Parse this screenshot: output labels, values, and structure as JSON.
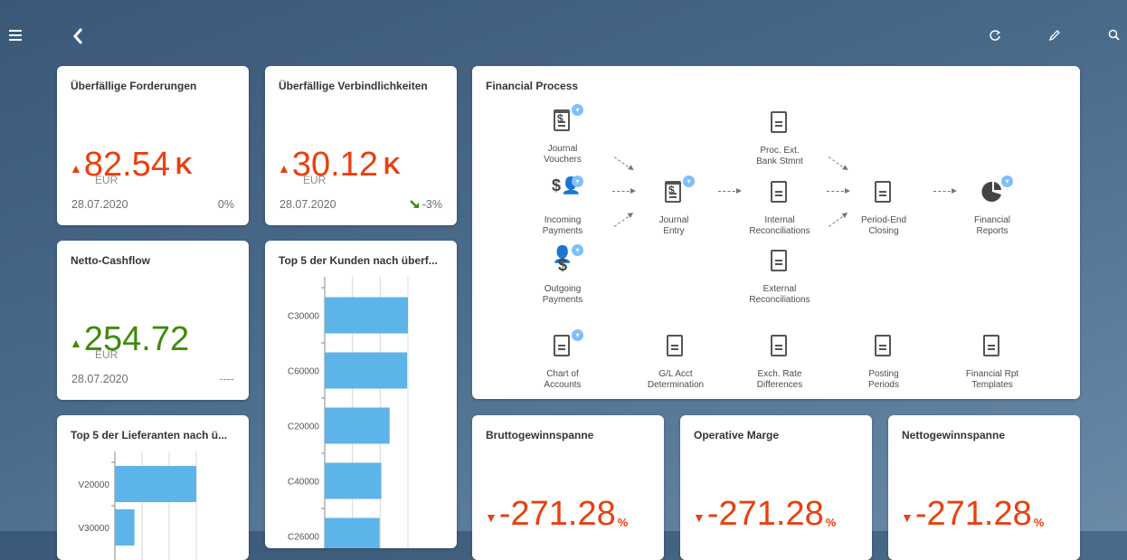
{
  "header": {
    "menu_icon": "hamburger-menu-icon",
    "back_icon": "back-chevron-icon",
    "refresh_icon": "refresh-icon",
    "edit_icon": "pencil-icon",
    "search_icon": "search-icon"
  },
  "tiles": {
    "receivables": {
      "title": "Überfällige Forderungen",
      "value": "82.54",
      "scale": "K",
      "unit": "EUR",
      "date": "28.07.2020",
      "delta": "0%",
      "trend": "up"
    },
    "payables": {
      "title": "Überfällige Verbindlichkeiten",
      "value": "30.12",
      "scale": "K",
      "unit": "EUR",
      "date": "28.07.2020",
      "delta": "-3%",
      "trend": "up"
    },
    "cashflow": {
      "title": "Netto-Cashflow",
      "value": "254.72",
      "unit": "EUR",
      "date": "28.07.2020",
      "delta": "----",
      "trend": "up"
    },
    "top_customers": {
      "title": "Top 5 der Kunden nach überf..."
    },
    "top_suppliers": {
      "title": "Top 5 der Lieferanten nach ü..."
    },
    "gross_margin": {
      "title": "Bruttogewinnspanne",
      "value": "-271.28",
      "unit": "%"
    },
    "operating_margin": {
      "title": "Operative Marge",
      "value": "-271.28",
      "unit": "%"
    },
    "net_margin": {
      "title": "Nettogewinnspanne",
      "value": "-271.28",
      "unit": "%"
    }
  },
  "financial_process": {
    "title": "Financial Process",
    "nodes": {
      "journal_vouchers": "Journal\nVouchers",
      "incoming_payments": "Incoming\nPayments",
      "outgoing_payments": "Outgoing\nPayments",
      "journal_entry": "Journal\nEntry",
      "proc_ext_bank": "Proc. Ext.\nBank Stmnt",
      "internal_recon": "Internal\nReconciliations",
      "external_recon": "External\nReconciliations",
      "period_end": "Period-End\nClosing",
      "financial_reports": "Financial\nReports",
      "chart_of_accounts": "Chart of\nAccounts",
      "gl_acct": "G/L Acct\nDetermination",
      "exch_rate": "Exch. Rate\nDifferences",
      "posting_periods": "Posting\nPeriods",
      "fin_rpt_templates": "Financial Rpt\nTemplates"
    }
  },
  "chart_data": [
    {
      "type": "bar",
      "orientation": "horizontal",
      "title": "Top 5 der Kunden nach überf...",
      "categories": [
        "C30000",
        "C60000",
        "C20000",
        "C40000",
        "C26000"
      ],
      "values": [
        100,
        99,
        78,
        68,
        66
      ]
    },
    {
      "type": "bar",
      "orientation": "horizontal",
      "title": "Top 5 der Lieferanten nach ü...",
      "categories": [
        "V20000",
        "V30000"
      ],
      "values": [
        100,
        24
      ]
    }
  ],
  "colors": {
    "negative": "#e9400e",
    "positive": "#3f8b09",
    "bar": "#5cb4e8",
    "badge": "#7fbfff"
  }
}
